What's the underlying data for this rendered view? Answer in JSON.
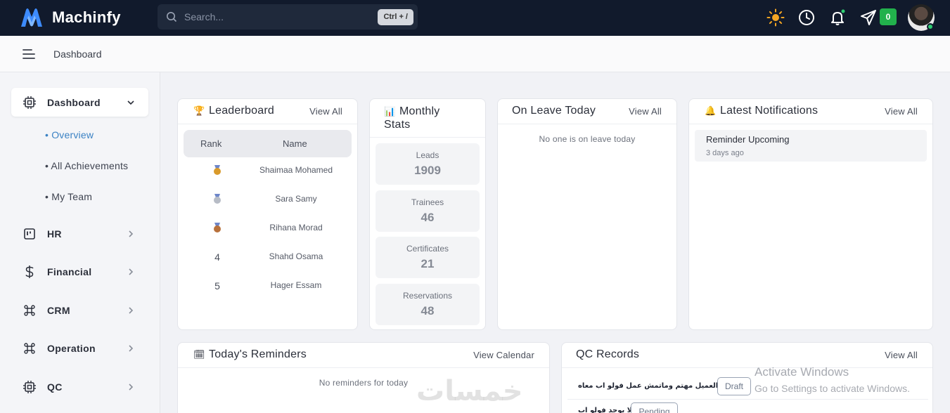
{
  "app": {
    "name": "Machinfy"
  },
  "search": {
    "placeholder": "Search...",
    "shortcut": "Ctrl + /"
  },
  "topbar": {
    "messages_count": "0"
  },
  "breadcrumb": {
    "current": "Dashboard"
  },
  "sidebar": {
    "items": [
      {
        "label": "Dashboard",
        "icon": "chip-icon",
        "expanded": true
      },
      {
        "label": "HR",
        "icon": "board-icon"
      },
      {
        "label": "Financial",
        "icon": "dollar-icon"
      },
      {
        "label": "CRM",
        "icon": "command-icon"
      },
      {
        "label": "Operation",
        "icon": "command-icon"
      },
      {
        "label": "QC",
        "icon": "chip-icon"
      }
    ],
    "subitems": [
      {
        "label": "Overview",
        "active": true
      },
      {
        "label": "All Achievements"
      },
      {
        "label": "My Team"
      }
    ]
  },
  "leaderboard": {
    "title": "Leaderboard",
    "link": "View All",
    "col_rank": "Rank",
    "col_name": "Name",
    "rows": [
      {
        "rank": "",
        "medal": "gold",
        "name": "Shaimaa Mohamed"
      },
      {
        "rank": "",
        "medal": "silver",
        "name": "Sara Samy"
      },
      {
        "rank": "",
        "medal": "bronze",
        "name": "Rihana Morad"
      },
      {
        "rank": "4",
        "name": "Shahd Osama"
      },
      {
        "rank": "5",
        "name": "Hager Essam"
      }
    ]
  },
  "monthly": {
    "title": "Monthly Stats",
    "stats": [
      {
        "label": "Leads",
        "value": "1909"
      },
      {
        "label": "Trainees",
        "value": "46"
      },
      {
        "label": "Certificates",
        "value": "21"
      },
      {
        "label": "Reservations",
        "value": "48"
      }
    ]
  },
  "leave": {
    "title": "On Leave Today",
    "link": "View All",
    "empty": "No one is on leave today"
  },
  "notifications": {
    "title": "Latest Notifications",
    "link": "View All",
    "items": [
      {
        "title": "Reminder Upcoming",
        "time": "3 days ago"
      }
    ]
  },
  "reminders": {
    "title": "Today's Reminders",
    "link": "View Calendar",
    "empty": "No reminders for today"
  },
  "qc": {
    "title": "QC Records",
    "link": "View All",
    "rows": [
      {
        "text": "مكتوب العميل مهتم وماتمش عمل فولو اب معاه",
        "status": "Draft"
      },
      {
        "text": "لا يوجد فولو اب",
        "status": "Pending"
      }
    ]
  },
  "overlay": {
    "activate_title": "Activate Windows",
    "activate_sub": "Go to Settings to activate Windows.",
    "khamsat": "خمسات"
  }
}
